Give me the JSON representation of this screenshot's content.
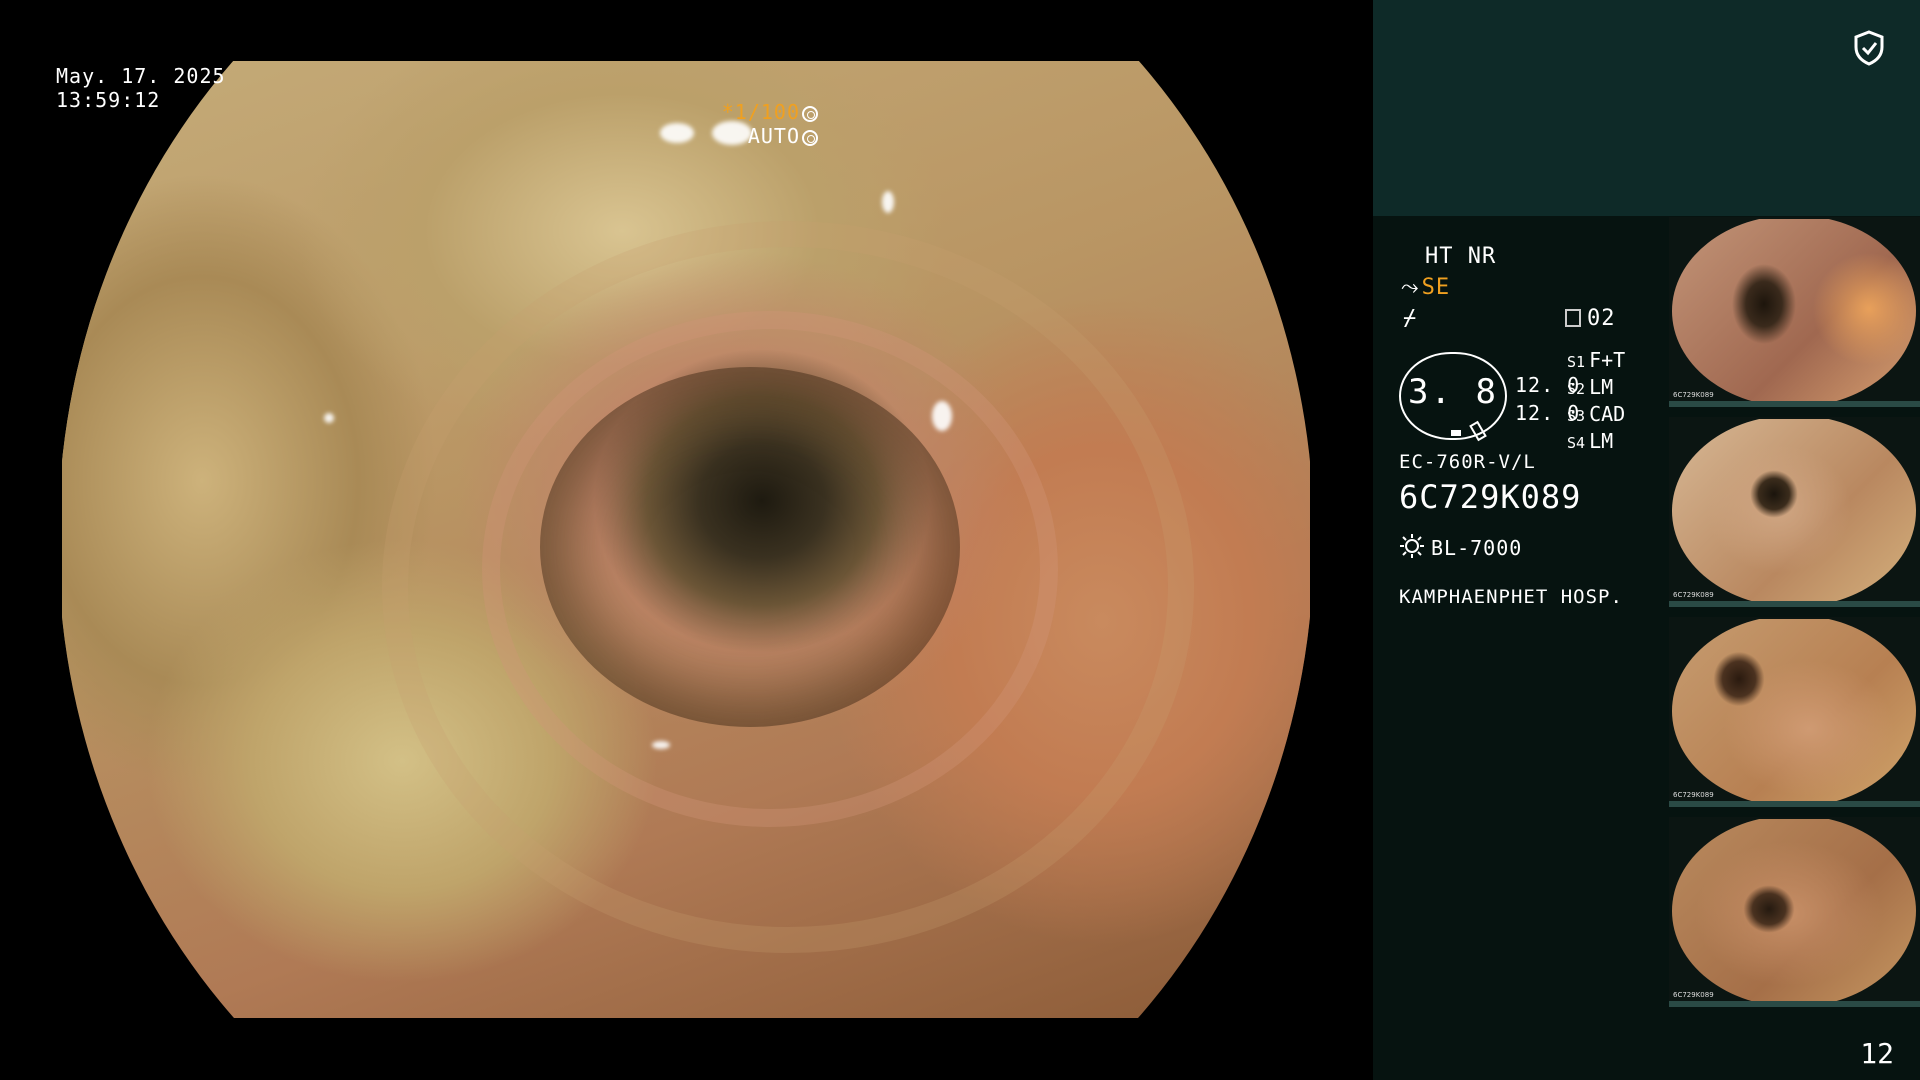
{
  "main_view": {
    "date": "May. 17. 2025",
    "time": "13:59:12",
    "exposure_ratio": "*1/100",
    "exposure_mode": "AUTO"
  },
  "panel": {
    "ht_nr": "HT NR",
    "se_label": "SE",
    "memo_count": "02",
    "gauge_value": "3. 8",
    "num_a": "12. 0",
    "num_b": "12. 0",
    "switches": [
      {
        "key": "S1",
        "value": "F+T"
      },
      {
        "key": "S2",
        "value": "LM"
      },
      {
        "key": "S3",
        "value": "CAD"
      },
      {
        "key": "S4",
        "value": "LM"
      }
    ],
    "scope_model": "EC-760R-V/L",
    "serial": "6C729K089",
    "light_source": "BL-7000",
    "hospital": "KAMPHAENPHET HOSP.",
    "page_number": "12"
  },
  "thumbnails": [
    {
      "label": "6C729K089"
    },
    {
      "label": "6C729K089"
    },
    {
      "label": "6C729K089"
    },
    {
      "label": "6C729K089"
    }
  ],
  "colors": {
    "accent_orange": "#f0a020",
    "panel_bg": "#061310",
    "header_bg": "#0e2a28"
  },
  "icons": [
    "shield-check-icon",
    "aperture-icon",
    "memo-icon",
    "light-source-icon",
    "scope-tip-icon"
  ]
}
